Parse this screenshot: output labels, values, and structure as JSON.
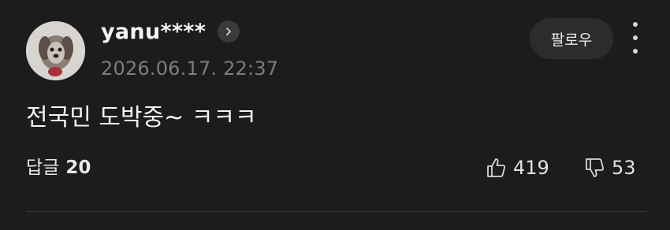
{
  "comment": {
    "username": "yanu****",
    "timestamp": "2026.06.17. 22:37",
    "follow_label": "팔로우",
    "text": "전국민 도박중~ ㅋㅋㅋ",
    "replies_label": "답글",
    "replies_count": "20",
    "likes": "419",
    "dislikes": "53"
  },
  "colors": {
    "background": "#1c1c1c",
    "text": "#f4f4f4",
    "muted": "#7d7d7d",
    "button_bg": "#2c2c2c"
  },
  "icons": {
    "profile": "chevron-right-icon",
    "more": "more-vertical-icon",
    "like": "thumbs-up-icon",
    "dislike": "thumbs-down-icon"
  }
}
